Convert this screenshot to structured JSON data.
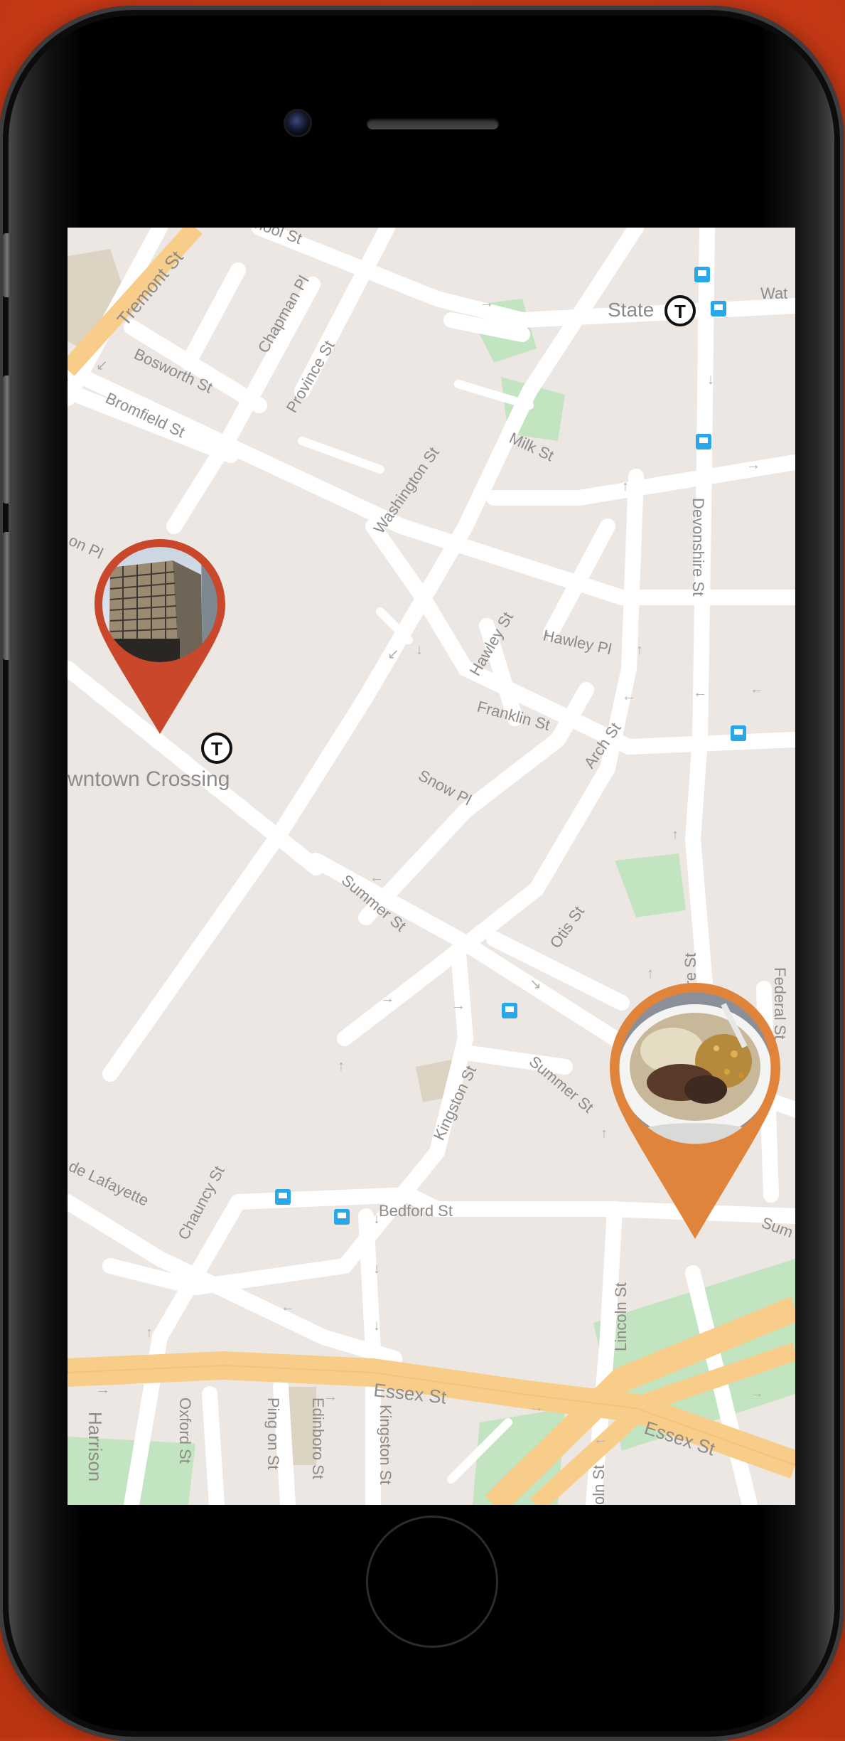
{
  "streets": {
    "tremont": "Tremont St",
    "school": "hool St",
    "chapman": "Chapman Pl",
    "province": "Province St",
    "bosworth": "Bosworth St",
    "bromfield": "Bromfield St",
    "washington": "Washington St",
    "milk": "Milk St",
    "devonshire": "Devonshire St",
    "devonshire2": "vonshire St",
    "hawley": "Hawley St",
    "hawley_pl": "Hawley Pl",
    "franklin": "Franklin St",
    "arch": "Arch St",
    "snow": "Snow Pl",
    "summer": "Summer St",
    "summer2": "Summer St",
    "summer3": "Sum",
    "otis": "Otis St",
    "federal": "Federal St",
    "kingston": "Kingston St",
    "kingston2": "Kingston St",
    "bedford": "Bedford St",
    "chauncy": "Chauncy St",
    "lafayette": "de Lafayette",
    "lincoln": "Lincoln St",
    "lincoln2": "oln St",
    "essex": "Essex St",
    "essex2": "Essex St",
    "oxford": "Oxford St",
    "ping_on": "Ping on St",
    "edinboro": "Edinboro St",
    "harrison": "Harrison",
    "water": "Wat",
    "on_pl": "on Pl"
  },
  "stations": {
    "state": "State",
    "downtown": "wntown Crossing"
  },
  "transit_symbol": "T",
  "pins": [
    {
      "name": "building-photo-pin",
      "color": "#c9472a",
      "photo": "building"
    },
    {
      "name": "food-photo-pin",
      "color": "#e0843c",
      "photo": "food bowl"
    }
  ],
  "colors": {
    "map_bg": "#ece7e2",
    "road": "#ffffff",
    "highway": "#f8cd8a",
    "park": "#c3e4c0",
    "label": "#8d8a88",
    "bus_stop": "#29a7e6"
  }
}
